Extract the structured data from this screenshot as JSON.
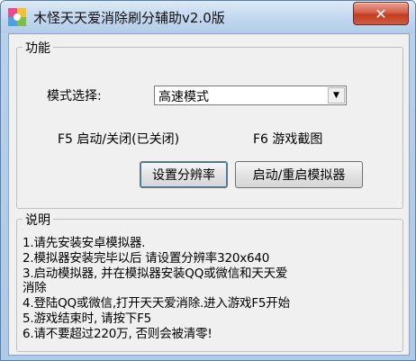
{
  "window": {
    "title": "木怪天天爱消除刷分辅助v2.0版",
    "close_label": "✕"
  },
  "features": {
    "group_title": "功能",
    "mode_label": "模式选择:",
    "mode_value": "高速模式",
    "f5_status": "F5 启动/关闭(已关闭)",
    "f6_label": "F6 游戏截图",
    "set_resolution_label": "设置分辨率",
    "restart_emulator_label": "启动/重启模拟器"
  },
  "instructions": {
    "group_title": "说明",
    "lines": [
      "1.请先安装安卓模拟器.",
      "2.模拟器安装完毕以后 请设置分辨率320x640",
      "3.启动模拟器, 并在模拟器安装QQ或微信和天天爱",
      "消除",
      "4.登陆QQ或微信,打开天天爱消除.进入游戏F5开始",
      "5.游戏结束时, 请按下F5",
      "6.请不要超过220万, 否则会被清零!"
    ]
  }
}
